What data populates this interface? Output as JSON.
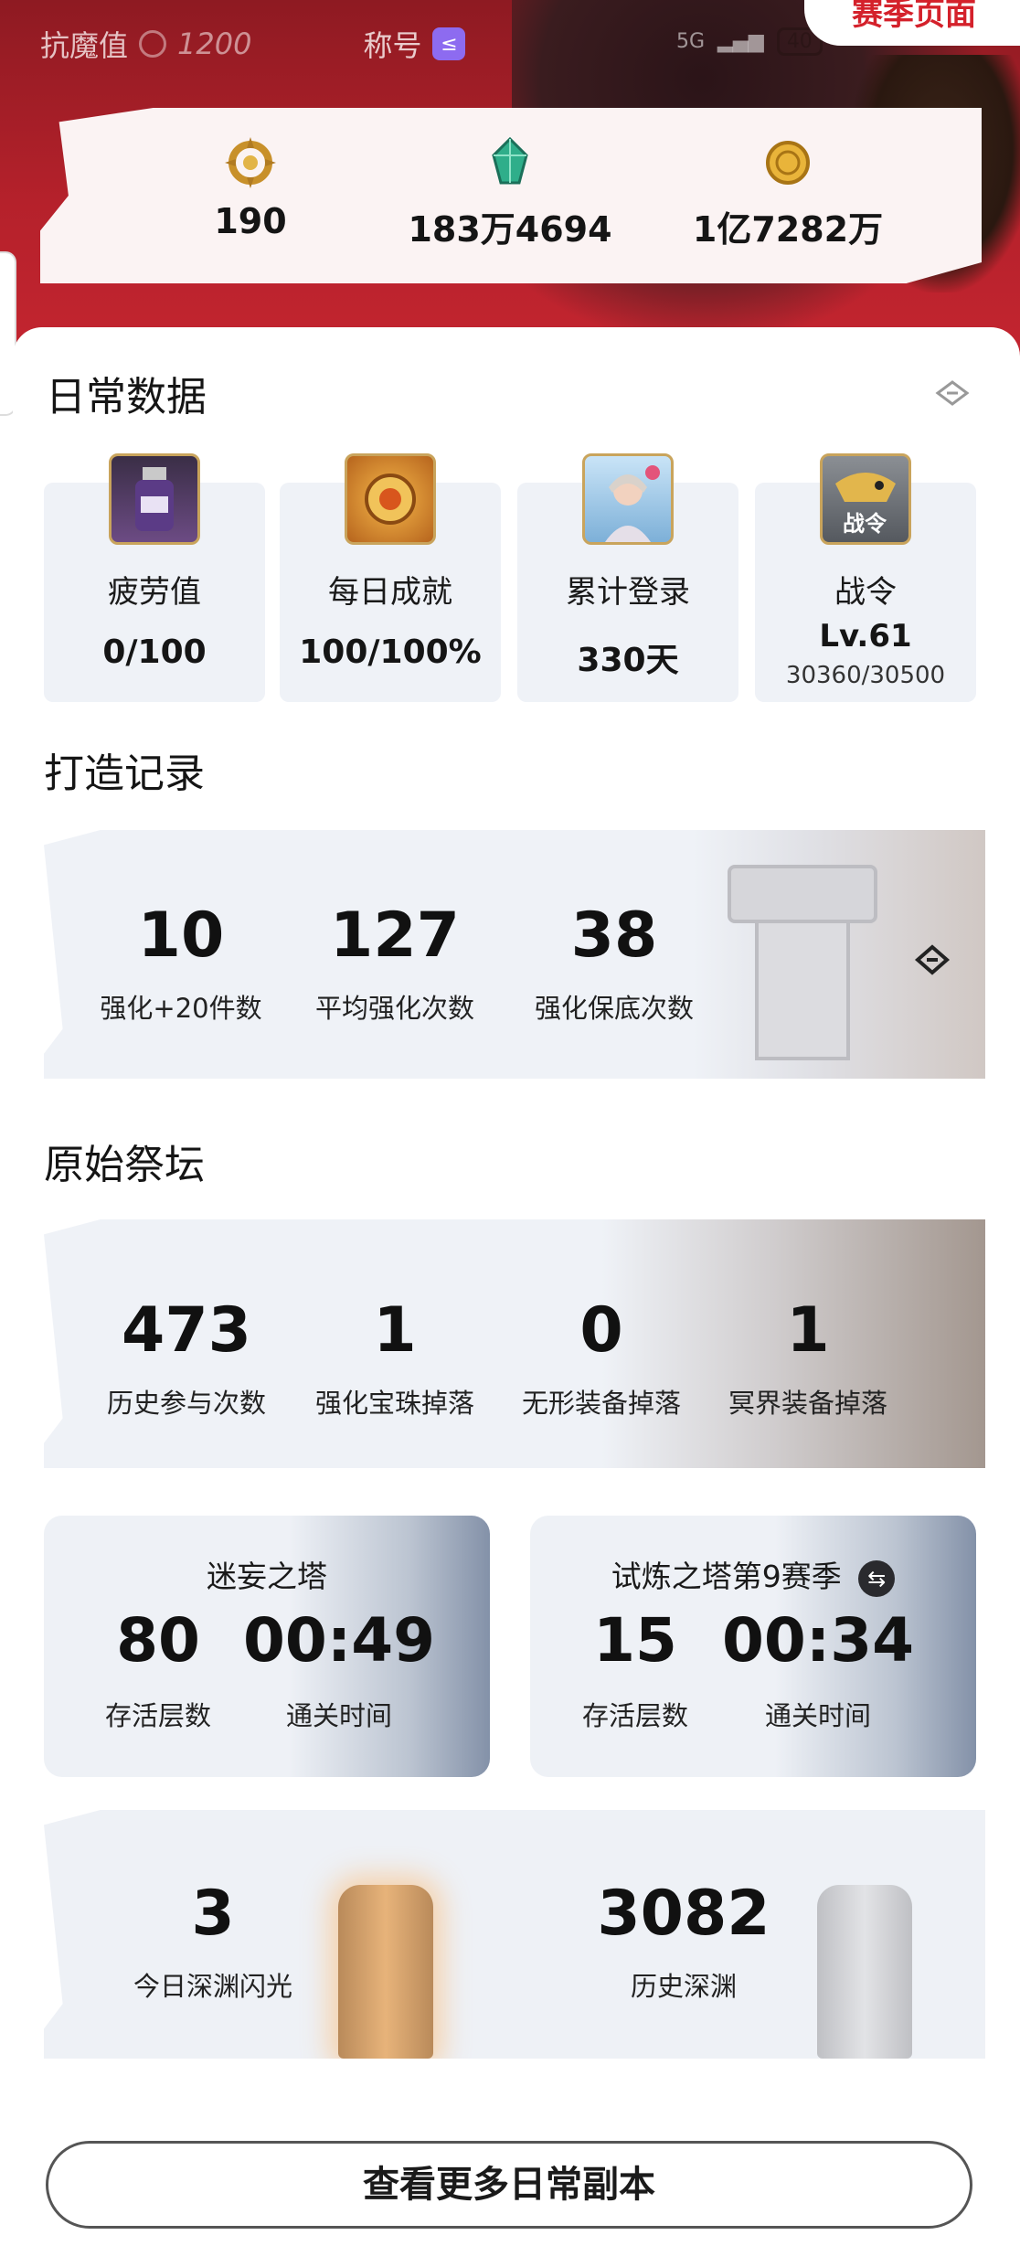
{
  "header": {
    "stat1_label": "抗魔值",
    "stat1_value": "1200",
    "stat2_label": "称号",
    "badge": "≤",
    "season_button": "赛季页面",
    "network": "5G",
    "battery": "40"
  },
  "currencies": [
    {
      "icon": "gold-emblem-icon",
      "value": "190"
    },
    {
      "icon": "green-crystal-icon",
      "value": "183万4694"
    },
    {
      "icon": "gold-coin-icon",
      "value": "1亿7282万"
    }
  ],
  "daily": {
    "title": "日常数据",
    "tiles": [
      {
        "icon": "fatigue-potion-icon",
        "label": "疲劳值",
        "value": "0/100"
      },
      {
        "icon": "achievement-medal-icon",
        "label": "每日成就",
        "value": "100/100%"
      },
      {
        "icon": "character-portrait-icon",
        "label": "累计登录",
        "value": "330天"
      },
      {
        "icon": "battle-pass-icon",
        "label": "战令",
        "level": "Lv.61",
        "progress": "30360/30500",
        "icon_text": "战令"
      }
    ]
  },
  "forge": {
    "title": "打造记录",
    "stats": [
      {
        "value": "10",
        "label": "强化+20件数"
      },
      {
        "value": "127",
        "label": "平均强化次数"
      },
      {
        "value": "38",
        "label": "强化保底次数"
      }
    ]
  },
  "altar": {
    "title": "原始祭坛",
    "stats": [
      {
        "value": "473",
        "label": "历史参与次数"
      },
      {
        "value": "1",
        "label": "强化宝珠掉落"
      },
      {
        "value": "0",
        "label": "无形装备掉落"
      },
      {
        "value": "1",
        "label": "冥界装备掉落"
      }
    ]
  },
  "towers": [
    {
      "title": "迷妄之塔",
      "floors": "80",
      "floors_label": "存活层数",
      "time": "00:49",
      "time_label": "通关时间"
    },
    {
      "title": "试炼之塔第9赛季",
      "floors": "15",
      "floors_label": "存活层数",
      "time": "00:34",
      "time_label": "通关时间"
    }
  ],
  "abyss": {
    "today_value": "3",
    "today_label": "今日深渊闪光",
    "history_value": "3082",
    "history_label": "历史深渊"
  },
  "more_button": "查看更多日常副本",
  "colors": {
    "banner_red": "#b5212b",
    "accent": "#d4212b",
    "panel": "#eff2f7"
  }
}
